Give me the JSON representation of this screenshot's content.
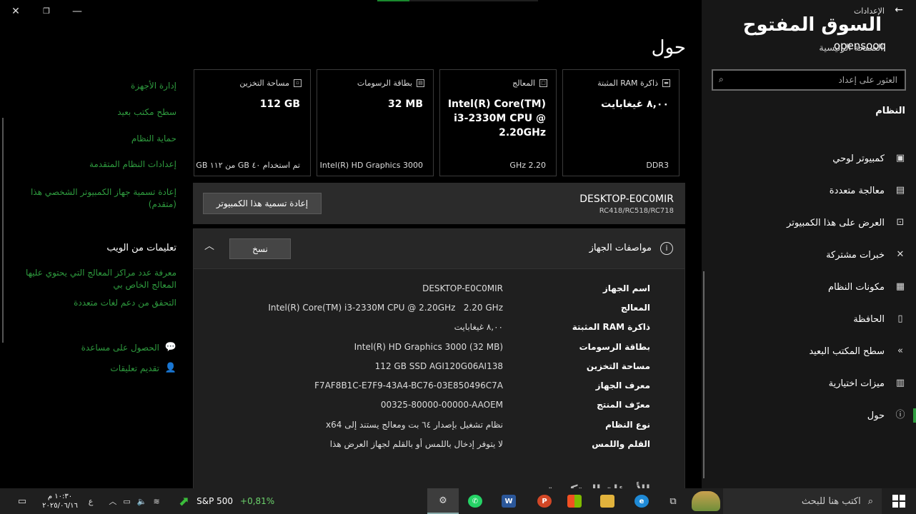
{
  "window": {
    "close_glyph": "✕",
    "restore_glyph": "❐",
    "min_glyph": "—"
  },
  "page": {
    "title": "حول"
  },
  "cards": [
    {
      "label": "ذاكرة RAM المثبتة",
      "value": "٨,٠٠ غيغابايت",
      "footer": "DDR3",
      "icon": "ram-icon"
    },
    {
      "label": "المعالج",
      "value": "Intel(R) Core(TM) i3-2330M CPU @ 2.20GHz",
      "footer": "2.20 GHz",
      "icon": "cpu-icon"
    },
    {
      "label": "بطاقة الرسومات",
      "value": "32 MB",
      "footer": "Intel(R) HD Graphics 3000",
      "icon": "gpu-icon"
    },
    {
      "label": "مساحة التخزين",
      "value": "112 GB",
      "footer": "تم استخدام ٤٠ GB من ١١٢ GB",
      "icon": "storage-icon"
    }
  ],
  "rename": {
    "device_name": "DESKTOP-E0C0MIR",
    "model": "RC418/RC518/RC718",
    "button": "إعادة تسمية هذا الكمبيوتر"
  },
  "specs": {
    "title": "مواصفات الجهاز",
    "copy_button": "نسخ",
    "rows": [
      {
        "label": "اسم الجهاز",
        "value": "DESKTOP-E0C0MIR"
      },
      {
        "label": "المعالج",
        "value": "Intel(R) Core(TM) i3-2330M CPU @ 2.20GHz   2.20 GHz"
      },
      {
        "label": "ذاكرة RAM المثبتة",
        "value": "٨,٠٠ غيغابايت"
      },
      {
        "label": "بطاقة الرسومات",
        "value": "Intel(R) HD Graphics 3000 (32 MB)"
      },
      {
        "label": "مساحة التخزين",
        "value": "112 GB SSD AGI120G06AI138"
      },
      {
        "label": "معرف الجهاز",
        "value": "F7AF8B1C-E7F9-43A4-BC76-03E850496C7A"
      },
      {
        "label": "معرّف المنتج",
        "value": "00325-80000-00000-AAOEM"
      },
      {
        "label": "نوع النظام",
        "value": "نظام تشغيل بإصدار ٦٤ بت ومعالج يستند إلى x64"
      },
      {
        "label": "القلم واللمس",
        "value": "لا يتوفر إدخال باللمس أو بالقلم لجهاز العرض هذا"
      }
    ],
    "faq_title": "الأسئلة المتكررة"
  },
  "related": {
    "links": [
      "إدارة الأجهزة",
      "سطح مكتب بعيد",
      "حماية النظام",
      "إعدادات النظام المتقدمة",
      "إعادة تسمية جهاز الكمبيوتر الشخصي هذا (متقدم)"
    ],
    "web_help_title": "تعليمات من الويب",
    "web_links": [
      "معرفة عدد مراكز المعالج التي يحتوي عليها المعالج الخاص بي",
      "التحقق من دعم لغات متعددة"
    ],
    "get_help": "الحصول على مساعدة",
    "feedback": "تقديم تعليقات"
  },
  "sidebar": {
    "back_glyph": "←",
    "app_title": "الإعدادات",
    "logo_text": "السوق المفتوح",
    "logo_latin": "opensooq",
    "home": "الصفحة الرئيسية",
    "search_placeholder": "العثور على إعداد",
    "section": "النظام",
    "items": [
      {
        "label": "كمبيوتر لوحي",
        "icon": "tablet-icon",
        "glyph": "▣"
      },
      {
        "label": "معالجة متعددة",
        "icon": "multitasking-icon",
        "glyph": "▤"
      },
      {
        "label": "العرض على هذا الكمبيوتر",
        "icon": "project-icon",
        "glyph": "⊡"
      },
      {
        "label": "خبرات مشتركة",
        "icon": "shared-icon",
        "glyph": "✕"
      },
      {
        "label": "مكونات النظام",
        "icon": "components-icon",
        "glyph": "▦"
      },
      {
        "label": "الحافظة",
        "icon": "clipboard-icon",
        "glyph": "▯"
      },
      {
        "label": "سطح المكتب البعيد",
        "icon": "remote-icon",
        "glyph": "»"
      },
      {
        "label": "ميزات اختيارية",
        "icon": "features-icon",
        "glyph": "▥"
      },
      {
        "label": "حول",
        "icon": "about-icon",
        "glyph": "ⓘ"
      }
    ]
  },
  "taskbar": {
    "search_text": "اكتب هنا للبحث",
    "stock_name": "S&P 500",
    "stock_change": "+0,81%",
    "time": "١٠:٣٠ م",
    "date": "٢٠٢٥/٠٦/١٦",
    "lang": "ع",
    "accent_green": "#2e9a3e"
  }
}
